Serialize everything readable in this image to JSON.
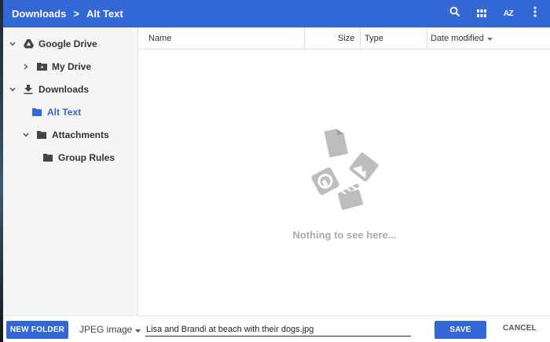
{
  "breadcrumb": {
    "root": "Downloads",
    "separator": ">",
    "current": "Alt Text"
  },
  "toolbar": {
    "icons": [
      "search-icon",
      "grid-view-icon",
      "sort-az-icon",
      "more-vert-icon"
    ],
    "sort_label": "AZ"
  },
  "sidebar": {
    "items": [
      {
        "label": "Google Drive",
        "icon": "google-drive-icon",
        "expanded": true
      },
      {
        "label": "My Drive",
        "icon": "drive-folder-icon",
        "expanded": false
      },
      {
        "label": "Downloads",
        "icon": "download-icon",
        "expanded": true
      },
      {
        "label": "Alt Text",
        "icon": "folder-icon",
        "selected": true
      },
      {
        "label": "Attachments",
        "icon": "folder-icon",
        "expanded": true
      },
      {
        "label": "Group Rules",
        "icon": "folder-icon"
      }
    ]
  },
  "columns": {
    "name": "Name",
    "size": "Size",
    "type": "Type",
    "date": "Date modified"
  },
  "empty_state": {
    "message": "Nothing to see here..."
  },
  "footer": {
    "new_folder": "NEW FOLDER",
    "file_type": "JPEG image",
    "filename": "Lisa and Brandi at beach with their dogs.jpg",
    "save": "SAVE",
    "cancel": "CANCEL"
  },
  "colors": {
    "accent": "#3367d6",
    "sidebar_bg": "#f5f5f5",
    "empty_art": "#bdbdbd"
  }
}
